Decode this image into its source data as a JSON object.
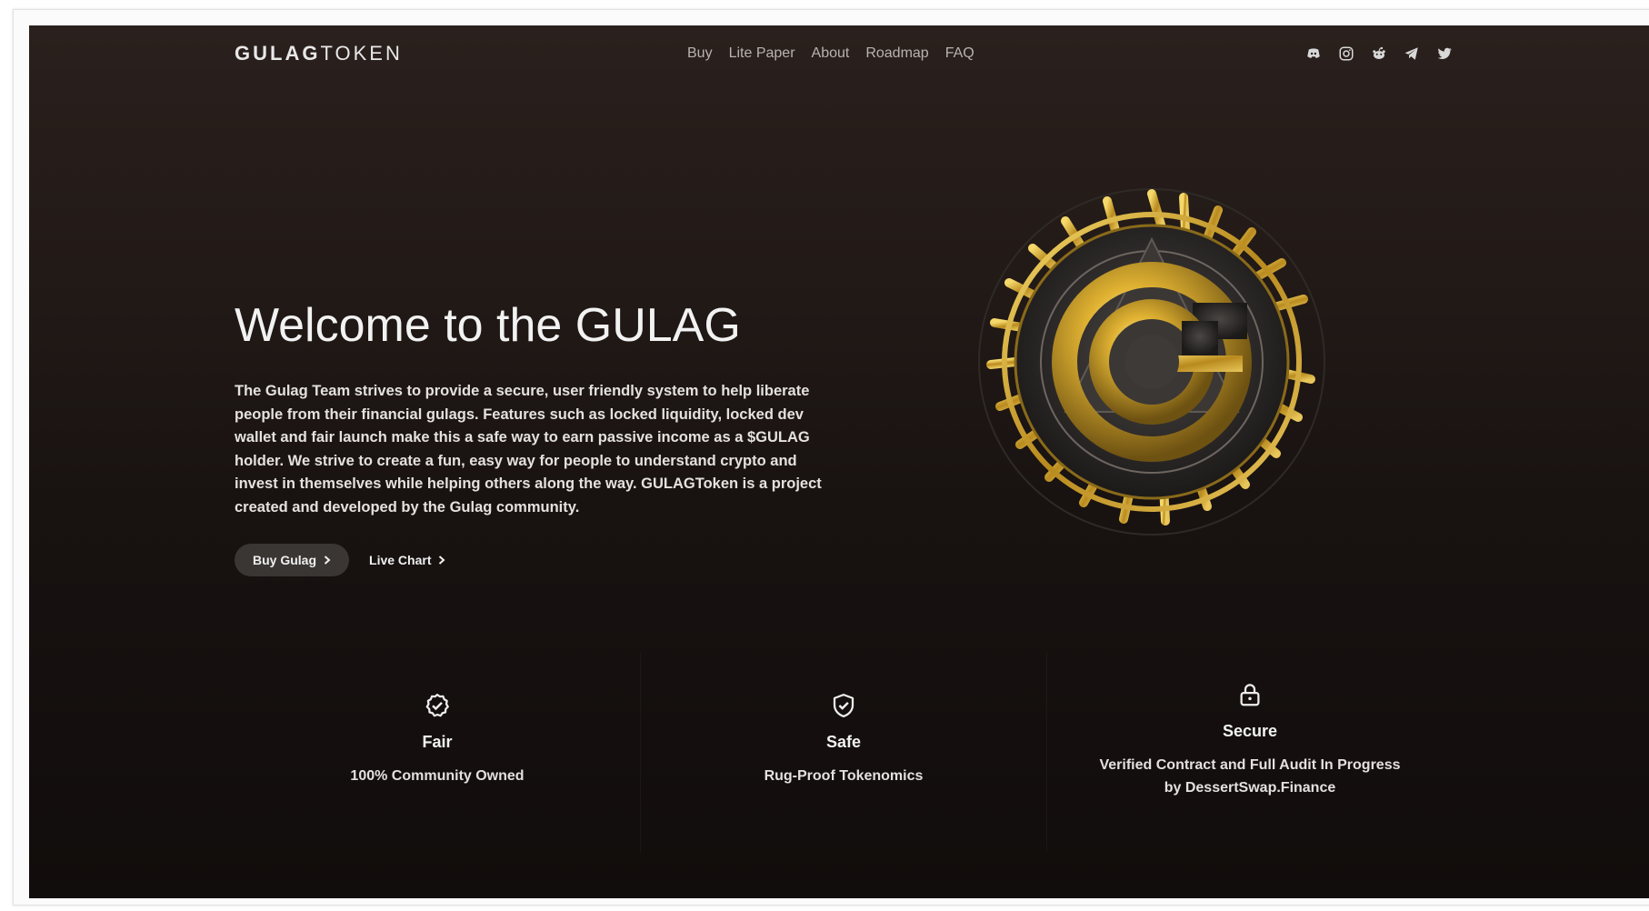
{
  "header": {
    "logo_bold": "GULAG",
    "logo_rest": "TOKEN",
    "nav": [
      "Buy",
      "Lite Paper",
      "About",
      "Roadmap",
      "FAQ"
    ],
    "social_icons": [
      "discord-icon",
      "instagram-icon",
      "reddit-icon",
      "telegram-icon",
      "twitter-icon"
    ]
  },
  "hero": {
    "title": "Welcome to the GULAG",
    "description": "The Gulag Team strives to provide a secure, user friendly system to help liberate people from their financial gulags. Features such as locked liquidity, locked dev wallet and fair launch make this a safe way to earn passive income as a $GULAG holder. We strive to create a fun, easy way for people to understand crypto and invest in themselves while helping others along the way. GULAGToken is a project created and developed by the Gulag community.",
    "buy_button": "Buy Gulag",
    "chart_link": "Live Chart"
  },
  "features": [
    {
      "title": "Fair",
      "desc": "100% Community Owned",
      "icon": "check-circle-icon"
    },
    {
      "title": "Safe",
      "desc": "Rug-Proof Tokenomics",
      "icon": "shield-check-icon"
    },
    {
      "title": "Secure",
      "desc": "Verified Contract and Full Audit In Progress by DessertSwap.Finance",
      "icon": "lock-icon"
    }
  ],
  "colors": {
    "background_top": "#2a201d",
    "background_bottom": "#110d0c",
    "gold": "#d4a72c",
    "text": "#f2f2f2"
  }
}
